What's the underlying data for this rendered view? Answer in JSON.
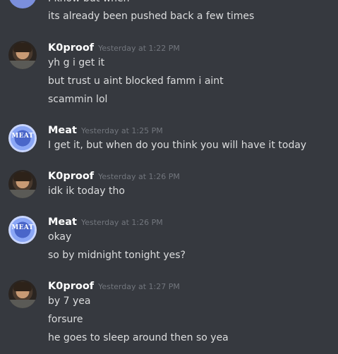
{
  "messages_top": {
    "cut_line": "I know but when",
    "line": "its already been pushed back a few times"
  },
  "groups": [
    {
      "author": "K0proof",
      "timestamp": "Yesterday at 1:22 PM",
      "lines": [
        "yh g i get it",
        "but trust u aint blocked famm i aint",
        "scammin lol"
      ]
    },
    {
      "author": "Meat",
      "avatar_text": "MEAT",
      "timestamp": "Yesterday at 1:25 PM",
      "lines": [
        "I get it, but when do you think you will have it today"
      ]
    },
    {
      "author": "K0proof",
      "timestamp": "Yesterday at 1:26 PM",
      "lines": [
        "idk ik today tho"
      ]
    },
    {
      "author": "Meat",
      "avatar_text": "MEAT",
      "timestamp": "Yesterday at 1:26 PM",
      "lines": [
        "okay",
        "so by midnight tonight yes?"
      ]
    },
    {
      "author": "K0proof",
      "timestamp": "Yesterday at 1:27 PM",
      "lines": [
        "by 7 yea",
        "forsure",
        "he goes to sleep around then so yea"
      ]
    }
  ],
  "colors": {
    "background": "#36393f",
    "author": "#ffffff",
    "timestamp": "#72767d",
    "message_text": "#dcddde"
  }
}
